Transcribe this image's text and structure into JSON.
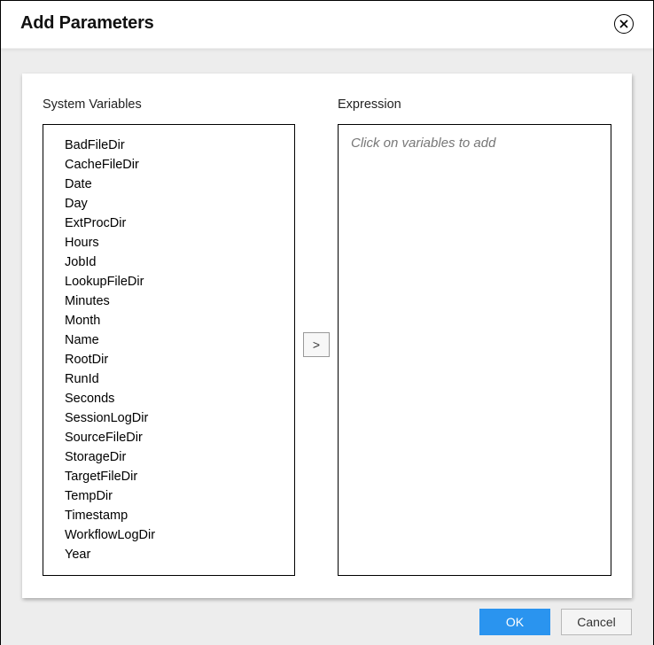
{
  "dialog": {
    "title": "Add Parameters"
  },
  "left": {
    "header": "System Variables",
    "items": [
      "BadFileDir",
      "CacheFileDir",
      "Date",
      "Day",
      "ExtProcDir",
      "Hours",
      "JobId",
      "LookupFileDir",
      "Minutes",
      "Month",
      "Name",
      "RootDir",
      "RunId",
      "Seconds",
      "SessionLogDir",
      "SourceFileDir",
      "StorageDir",
      "TargetFileDir",
      "TempDir",
      "Timestamp",
      "WorkflowLogDir",
      "Year"
    ]
  },
  "mid": {
    "move_label": ">"
  },
  "right": {
    "header": "Expression",
    "placeholder": "Click on variables to add",
    "value": ""
  },
  "footer": {
    "ok_label": "OK",
    "cancel_label": "Cancel"
  }
}
